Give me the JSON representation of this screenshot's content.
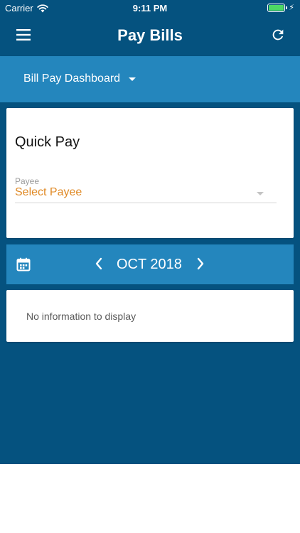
{
  "status_bar": {
    "carrier": "Carrier",
    "time": "9:11 PM"
  },
  "nav": {
    "title": "Pay Bills",
    "menu_icon": "hamburger-menu-icon",
    "refresh_icon": "refresh-icon"
  },
  "dashboard": {
    "label": "Bill Pay Dashboard"
  },
  "quick_pay": {
    "title": "Quick Pay",
    "payee_label": "Payee",
    "payee_value": "Select Payee"
  },
  "month_nav": {
    "month": "OCT 2018",
    "calendar_icon": "calendar-icon"
  },
  "info": {
    "message": "No information to display"
  },
  "colors": {
    "primary": "#05527f",
    "secondary": "#2486bd",
    "accent": "#e08a26",
    "battery": "#4cd964"
  }
}
